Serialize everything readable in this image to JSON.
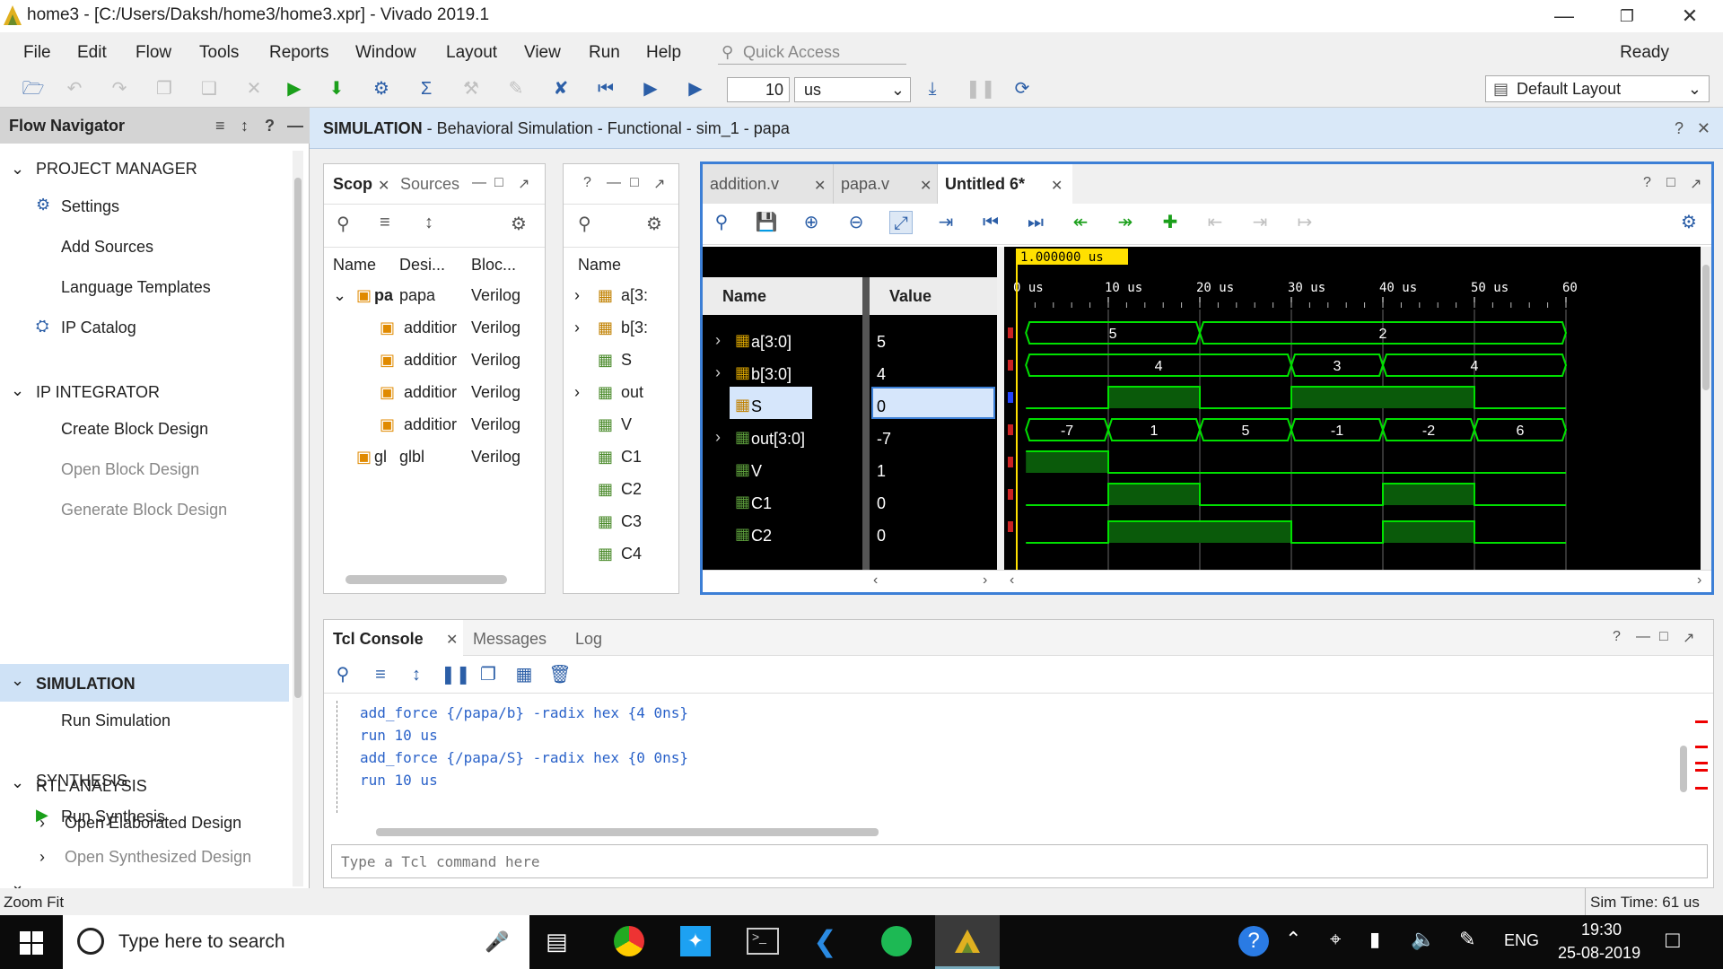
{
  "window": {
    "title": "home3 - [C:/Users/Daksh/home3/home3.xpr] - Vivado 2019.1"
  },
  "menu": [
    "File",
    "Edit",
    "Flow",
    "Tools",
    "Reports",
    "Window",
    "Layout",
    "View",
    "Run",
    "Help"
  ],
  "quick_access": "Quick Access",
  "ready": "Ready",
  "toolbar": {
    "time_value": "10",
    "time_unit": "us",
    "layout": "Default Layout"
  },
  "flow_navigator": {
    "title": "Flow Navigator",
    "project_manager": "PROJECT MANAGER",
    "settings": "Settings",
    "add_sources": "Add Sources",
    "language_templates": "Language Templates",
    "ip_catalog": "IP Catalog",
    "ip_integrator": "IP INTEGRATOR",
    "create_block_design": "Create Block Design",
    "open_block_design": "Open Block Design",
    "generate_block_design": "Generate Block Design",
    "simulation": "SIMULATION",
    "run_simulation": "Run Simulation",
    "rtl_analysis": "RTL ANALYSIS",
    "open_elaborated_design": "Open Elaborated Design",
    "synthesis": "SYNTHESIS",
    "run_synthesis": "Run Synthesis",
    "open_synthesized_design": "Open Synthesized Design"
  },
  "sim_header": {
    "bold": "SIMULATION",
    "rest": " - Behavioral Simulation - Functional - sim_1 - papa"
  },
  "scope": {
    "tab_scope": "Scop",
    "tab_sources": "Sources",
    "headers": [
      "Name",
      "Desi...",
      "Bloc..."
    ],
    "rows": [
      {
        "name": "pa",
        "design": "papa",
        "block": "Verilog"
      },
      {
        "name": "",
        "design": "additior",
        "block": "Verilog"
      },
      {
        "name": "",
        "design": "additior",
        "block": "Verilog"
      },
      {
        "name": "",
        "design": "additior",
        "block": "Verilog"
      },
      {
        "name": "",
        "design": "additior",
        "block": "Verilog"
      },
      {
        "name": "gl",
        "design": "glbl",
        "block": "Verilog"
      }
    ]
  },
  "objects": {
    "header": "Name",
    "rows": [
      "a[3:",
      "b[3:",
      "S",
      "out",
      "V",
      "C1",
      "C2",
      "C3",
      "C4"
    ]
  },
  "wave": {
    "tabs": [
      "addition.v",
      "papa.v",
      "Untitled 6*"
    ],
    "cursor_label": "1.000000 us",
    "name_header": "Name",
    "value_header": "Value",
    "signals": [
      {
        "name": "a[3:0]",
        "value": "5"
      },
      {
        "name": "b[3:0]",
        "value": "4"
      },
      {
        "name": "S",
        "value": "0"
      },
      {
        "name": "out[3:0]",
        "value": "-7"
      },
      {
        "name": "V",
        "value": "1"
      },
      {
        "name": "C1",
        "value": "0"
      },
      {
        "name": "C2",
        "value": "0"
      }
    ],
    "ticks": [
      "0 us",
      "10 us",
      "20 us",
      "30 us",
      "40 us",
      "50 us",
      "60"
    ],
    "bus_a": [
      "5",
      "2"
    ],
    "bus_b": [
      "4",
      "3",
      "4"
    ],
    "bus_out": [
      "-7",
      "1",
      "5",
      "-1",
      "-2",
      "6"
    ],
    "colors": {
      "wave": "#00e000",
      "cursor": "#ffe000",
      "background": "#000000"
    }
  },
  "console": {
    "tabs": [
      "Tcl Console",
      "Messages",
      "Log"
    ],
    "lines": [
      "add_force {/papa/b} -radix hex {4 0ns}",
      "run 10 us",
      "add_force {/papa/S} -radix hex {0 0ns}",
      "run 10 us"
    ],
    "placeholder": "Type a Tcl command here"
  },
  "status": {
    "left": "Zoom Fit",
    "right": "Sim Time: 61 us"
  },
  "taskbar": {
    "search": "Type here to search",
    "lang": "ENG",
    "time": "19:30",
    "date": "25-08-2019"
  }
}
